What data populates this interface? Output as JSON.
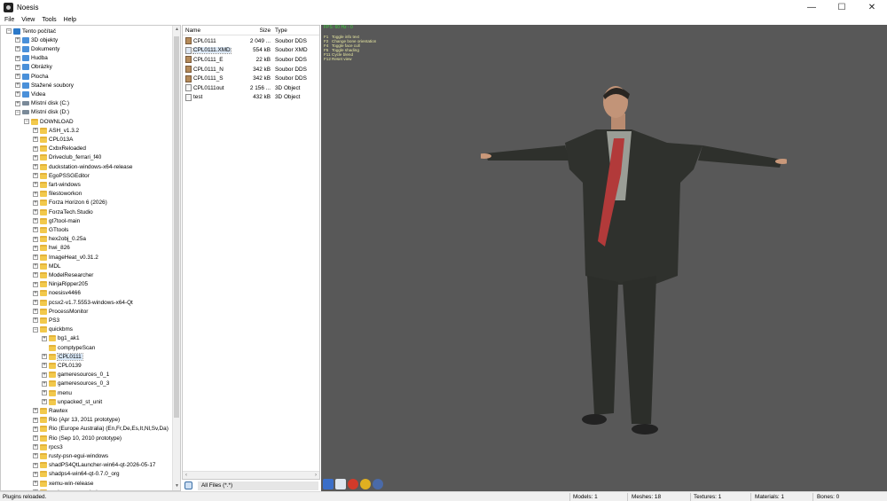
{
  "window": {
    "title": "Noesis",
    "controls": [
      "—",
      "☐",
      "✕"
    ]
  },
  "menu": [
    "File",
    "View",
    "Tools",
    "Help"
  ],
  "tree": {
    "items": [
      {
        "label": "Tento počítač",
        "icon": "computer-icon",
        "level": 0,
        "expander": "−"
      },
      {
        "label": "3D objekty",
        "icon": "folder-3d-icon",
        "level": 1,
        "expander": "+"
      },
      {
        "label": "Dokumenty",
        "icon": "documents-folder-icon",
        "level": 1,
        "expander": "+"
      },
      {
        "label": "Hudba",
        "icon": "music-folder-icon",
        "level": 1,
        "expander": "+"
      },
      {
        "label": "Obrázky",
        "icon": "pictures-folder-icon",
        "level": 1,
        "expander": "+"
      },
      {
        "label": "Plocha",
        "icon": "desktop-folder-icon",
        "level": 1,
        "expander": "+"
      },
      {
        "label": "Stažené soubory",
        "icon": "downloads-folder-icon",
        "level": 1,
        "expander": "+"
      },
      {
        "label": "Videa",
        "icon": "videos-folder-icon",
        "level": 1,
        "expander": "+"
      },
      {
        "label": "Místní disk (C:)",
        "icon": "drive-icon",
        "level": 1,
        "expander": "+"
      },
      {
        "label": "Místní disk (D:)",
        "icon": "drive-icon",
        "level": 1,
        "expander": "−"
      },
      {
        "label": "DOWNLOAD",
        "icon": "folder-icon",
        "level": 2,
        "expander": "−"
      },
      {
        "label": "ASH_v1.3.2",
        "icon": "folder-icon",
        "level": 3,
        "expander": "+"
      },
      {
        "label": "CPL013A",
        "icon": "folder-icon",
        "level": 3,
        "expander": "+"
      },
      {
        "label": "CxbxReloaded",
        "icon": "folder-icon",
        "level": 3,
        "expander": "+"
      },
      {
        "label": "Driveclub_ferrari_f40",
        "icon": "folder-icon",
        "level": 3,
        "expander": "+"
      },
      {
        "label": "duckstation-windows-x64-release",
        "icon": "folder-icon",
        "level": 3,
        "expander": "+"
      },
      {
        "label": "EgoPSSGEditor",
        "icon": "folder-icon",
        "level": 3,
        "expander": "+"
      },
      {
        "label": "fart-windows",
        "icon": "folder-icon",
        "level": 3,
        "expander": "+"
      },
      {
        "label": "filestoworkon",
        "icon": "folder-icon",
        "level": 3,
        "expander": "+"
      },
      {
        "label": "Forza Horizon 6 (2026)",
        "icon": "folder-icon",
        "level": 3,
        "expander": "+"
      },
      {
        "label": "ForzaTech.Studio",
        "icon": "folder-icon",
        "level": 3,
        "expander": "+"
      },
      {
        "label": "gt7tool-main",
        "icon": "folder-icon",
        "level": 3,
        "expander": "+"
      },
      {
        "label": "GTtools",
        "icon": "folder-icon",
        "level": 3,
        "expander": "+"
      },
      {
        "label": "hex2obj_0.25a",
        "icon": "folder-icon",
        "level": 3,
        "expander": "+"
      },
      {
        "label": "hwi_826",
        "icon": "folder-icon",
        "level": 3,
        "expander": "+"
      },
      {
        "label": "ImageHeat_v0.31.2",
        "icon": "folder-icon",
        "level": 3,
        "expander": "+"
      },
      {
        "label": "MDL",
        "icon": "folder-icon",
        "level": 3,
        "expander": "+"
      },
      {
        "label": "ModelResearcher",
        "icon": "folder-icon",
        "level": 3,
        "expander": "+"
      },
      {
        "label": "NinjaRipper205",
        "icon": "folder-icon",
        "level": 3,
        "expander": "+"
      },
      {
        "label": "noesisv4466",
        "icon": "folder-icon",
        "level": 3,
        "expander": "+"
      },
      {
        "label": "pcsx2-v1.7.5553-windows-x64-Qt",
        "icon": "folder-icon",
        "level": 3,
        "expander": "+"
      },
      {
        "label": "ProcessMonitor",
        "icon": "folder-icon",
        "level": 3,
        "expander": "+"
      },
      {
        "label": "PS3",
        "icon": "folder-icon",
        "level": 3,
        "expander": "+"
      },
      {
        "label": "quickbms",
        "icon": "folder-icon",
        "level": 3,
        "expander": "−"
      },
      {
        "label": "bg1_ak1",
        "icon": "folder-icon",
        "level": 4,
        "expander": "+"
      },
      {
        "label": "comptypeScan",
        "icon": "folder-icon",
        "level": 4,
        "expander": ""
      },
      {
        "label": "CPL0111",
        "icon": "folder-icon",
        "level": 4,
        "expander": "+",
        "selected": true
      },
      {
        "label": "CPL0139",
        "icon": "folder-icon",
        "level": 4,
        "expander": "+"
      },
      {
        "label": "gameresources_0_1",
        "icon": "folder-icon",
        "level": 4,
        "expander": "+"
      },
      {
        "label": "gameresources_0_3",
        "icon": "folder-icon",
        "level": 4,
        "expander": "+"
      },
      {
        "label": "menu",
        "icon": "folder-icon",
        "level": 4,
        "expander": "+"
      },
      {
        "label": "unpacked_st_unit",
        "icon": "folder-icon",
        "level": 4,
        "expander": "+"
      },
      {
        "label": "Rawtex",
        "icon": "folder-icon",
        "level": 3,
        "expander": "+"
      },
      {
        "label": "Rio (Apr 13, 2011 prototype)",
        "icon": "folder-icon",
        "level": 3,
        "expander": "+"
      },
      {
        "label": "Rio (Europe Australia) (En,Fr,De,Es,It,Nl,Sv,Da)",
        "icon": "folder-icon",
        "level": 3,
        "expander": "+"
      },
      {
        "label": "Rio (Sep 10, 2010 prototype)",
        "icon": "folder-icon",
        "level": 3,
        "expander": "+"
      },
      {
        "label": "rpcs3",
        "icon": "folder-icon",
        "level": 3,
        "expander": "+"
      },
      {
        "label": "rusty-psn-egui-windows",
        "icon": "folder-icon",
        "level": 3,
        "expander": "+"
      },
      {
        "label": "shadPS4QtLauncher-win64-qt-2026-05-17",
        "icon": "folder-icon",
        "level": 3,
        "expander": "+"
      },
      {
        "label": "shadps4-win64-qt-0.7.0_org",
        "icon": "folder-icon",
        "level": 3,
        "expander": "+"
      },
      {
        "label": "xemu-win-release",
        "icon": "folder-icon",
        "level": 3,
        "expander": "+"
      },
      {
        "label": "xenia_canary_windows",
        "icon": "folder-icon",
        "level": 3,
        "expander": "+"
      }
    ]
  },
  "files": {
    "headers": {
      "name": "Name",
      "size": "Size",
      "type": "Type"
    },
    "rows": [
      {
        "name": "CPL0111",
        "size": "2 049 ...",
        "type": "Soubor DDS",
        "icon": "dds-file-icon"
      },
      {
        "name": "CPL0111.XMD",
        "size": "554 kB",
        "type": "Soubor XMD",
        "icon": "xmd-file-icon",
        "selected": true
      },
      {
        "name": "CPL0111_E",
        "size": "22 kB",
        "type": "Soubor DDS",
        "icon": "dds-file-icon"
      },
      {
        "name": "CPL0111_N",
        "size": "342 kB",
        "type": "Soubor DDS",
        "icon": "dds-file-icon"
      },
      {
        "name": "CPL0111_S",
        "size": "342 kB",
        "type": "Soubor DDS",
        "icon": "dds-file-icon"
      },
      {
        "name": "CPL0111out",
        "size": "2 156 ...",
        "type": "3D Object",
        "icon": "3d-object-file-icon"
      },
      {
        "name": "test",
        "size": "432 kB",
        "type": "3D Object",
        "icon": "3d-object-file-icon"
      }
    ],
    "filter": "All Files (*.*)"
  },
  "viewport": {
    "fps": "FPS: 60 Hz - 0",
    "help": [
      {
        "key": "F1",
        "text": "Toggle info text"
      },
      {
        "key": "F2",
        "text": "Change bone orientation"
      },
      {
        "key": "F4",
        "text": "Toggle face cull"
      },
      {
        "key": "F5",
        "text": "Toggle shading"
      },
      {
        "key": "F11",
        "text": "Cycle blend"
      },
      {
        "key": "F12",
        "text": "Reset view"
      }
    ],
    "background": "#585858"
  },
  "statusbar": {
    "message": "Plugins reloaded.",
    "models": "Models: 1",
    "meshes": "Meshes: 18",
    "textures": "Textures: 1",
    "materials": "Materials: 1",
    "bones": "Bones: 0"
  }
}
